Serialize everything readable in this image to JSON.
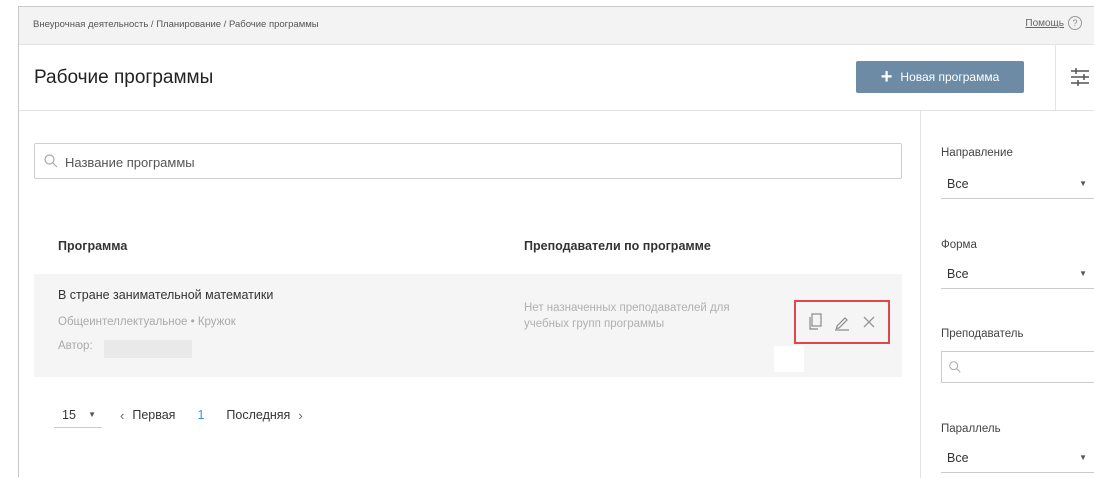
{
  "topbar": {
    "breadcrumb": "Внеурочная деятельность / Планирование / Рабочие программы",
    "help_label": "Помощь",
    "help_icon": "?"
  },
  "header": {
    "title": "Рабочие программы",
    "new_button_label": "Новая программа",
    "new_button_icon": "+"
  },
  "search": {
    "placeholder": "Название программы"
  },
  "table": {
    "columns": [
      "Программа",
      "Преподаватели по программе"
    ],
    "rows": [
      {
        "name": "В стране занимательной математики",
        "meta": "Общеинтеллектуальное • Кружок",
        "author_label": "Автор:",
        "teachers": "Нет назначенных преподавателей для учебных групп программы"
      }
    ]
  },
  "pagination": {
    "page_size": "15",
    "first_label": "Первая",
    "current_page": "1",
    "last_label": "Последняя",
    "prev_icon": "‹",
    "next_icon": "›"
  },
  "filters": {
    "direction": {
      "label": "Направление",
      "value": "Все"
    },
    "form": {
      "label": "Форма",
      "value": "Все"
    },
    "teacher": {
      "label": "Преподаватель",
      "placeholder": ""
    },
    "parallel": {
      "label": "Параллель",
      "value": "Все"
    }
  },
  "colors": {
    "primary_button": "#6d8ba5",
    "highlight_border": "#e04848",
    "link": "#3a9ad9",
    "row_bg": "#f5f5f5"
  }
}
